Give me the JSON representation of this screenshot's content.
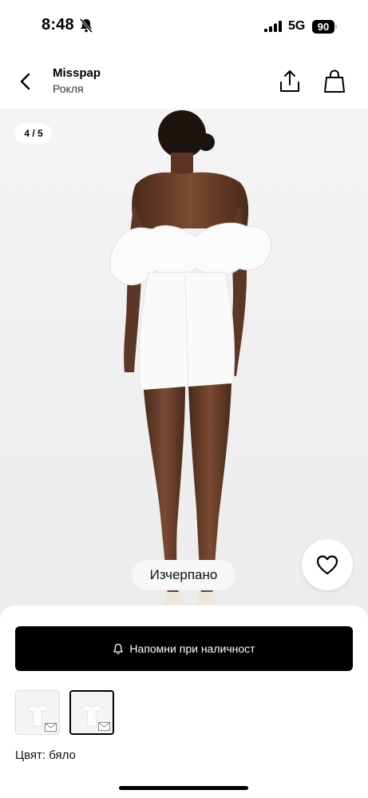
{
  "status_bar": {
    "time": "8:48",
    "network": "5G",
    "battery": "90"
  },
  "header": {
    "brand": "Misspap",
    "category": "Рокля"
  },
  "gallery": {
    "position": "4 / 5",
    "availability": "Изчерпано"
  },
  "notify_button": {
    "label": "Напомни при наличност"
  },
  "color": {
    "label": "Цвят: бяло"
  },
  "icons": [
    "bell-off-icon",
    "signal-icon",
    "back-arrow-icon",
    "share-icon",
    "shopping-bag-icon",
    "heart-icon",
    "bell-icon",
    "mail-icon"
  ]
}
